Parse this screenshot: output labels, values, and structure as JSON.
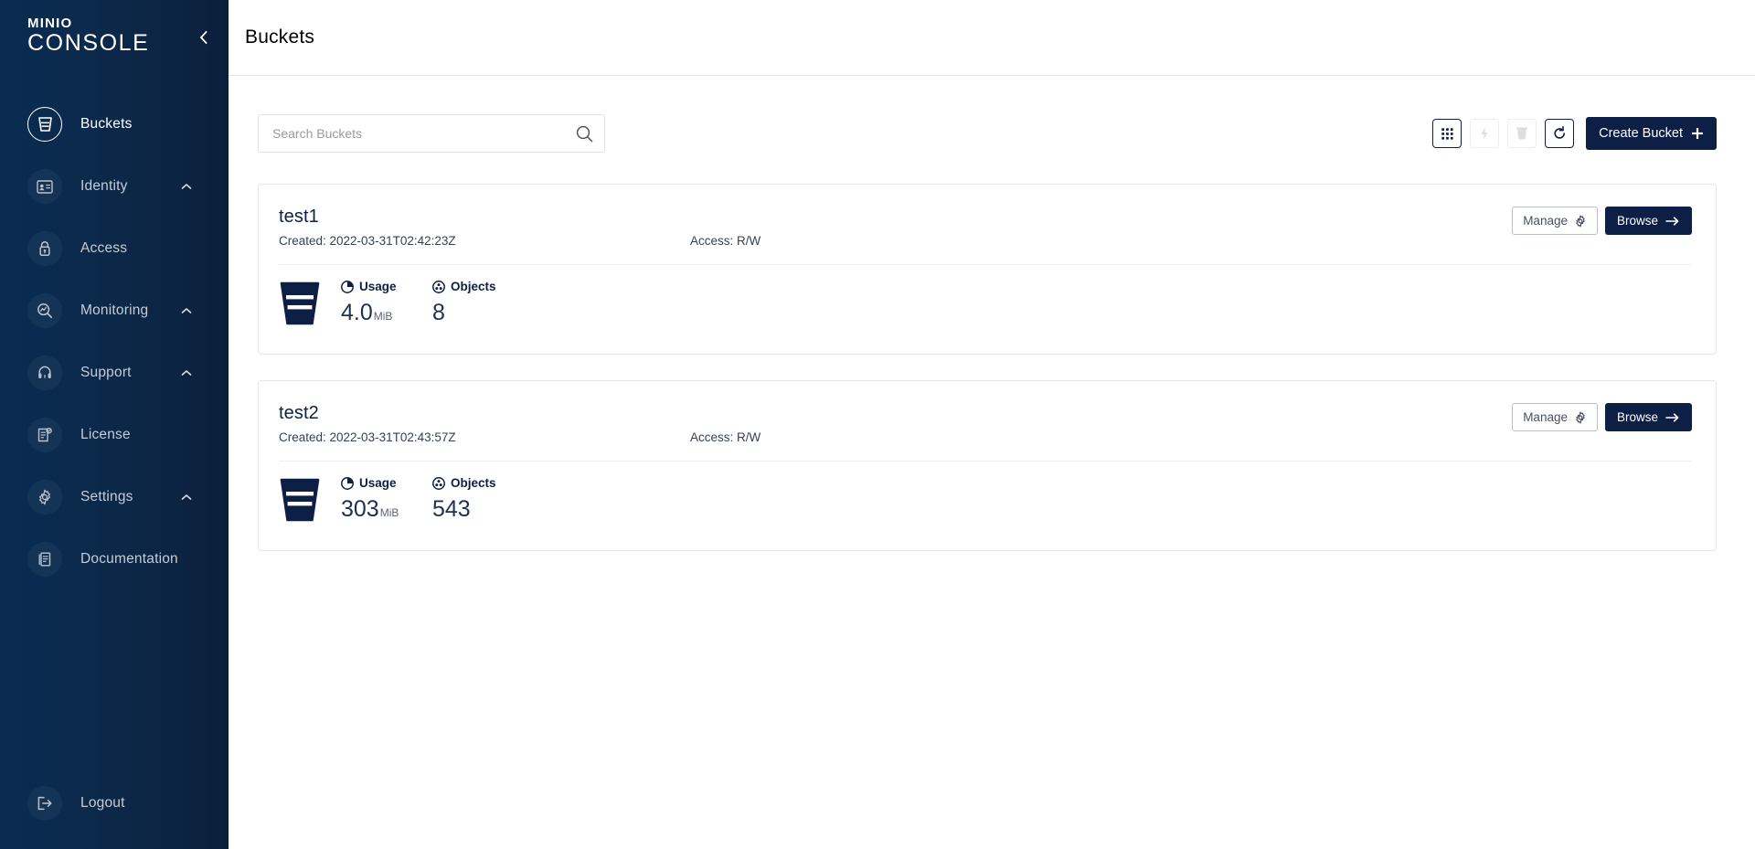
{
  "sidebar": {
    "logo_top": "MINIO",
    "logo_bottom": "CONSOLE",
    "collapse_icon": "chevron-left-icon",
    "items": [
      {
        "label": "Buckets",
        "icon": "bucket-icon",
        "active": true,
        "chevron": false
      },
      {
        "label": "Identity",
        "icon": "identity-card-icon",
        "active": false,
        "chevron": true
      },
      {
        "label": "Access",
        "icon": "lock-icon",
        "active": false,
        "chevron": false
      },
      {
        "label": "Monitoring",
        "icon": "magnifier-chart-icon",
        "active": false,
        "chevron": true
      },
      {
        "label": "Support",
        "icon": "support-headset-icon",
        "active": false,
        "chevron": true
      },
      {
        "label": "License",
        "icon": "license-doc-icon",
        "active": false,
        "chevron": false
      },
      {
        "label": "Settings",
        "icon": "gear-icon",
        "active": false,
        "chevron": true
      },
      {
        "label": "Documentation",
        "icon": "book-icon",
        "active": false,
        "chevron": false
      }
    ],
    "logout": {
      "label": "Logout",
      "icon": "logout-icon"
    }
  },
  "header": {
    "title": "Buckets"
  },
  "toolbar": {
    "search": {
      "placeholder": "Search Buckets",
      "value": "",
      "icon": "search-icon"
    },
    "buttons": [
      {
        "name": "grid-view-button",
        "icon": "grid-icon",
        "disabled": false
      },
      {
        "name": "lifecycle-button",
        "icon": "bolt-icon",
        "disabled": true
      },
      {
        "name": "delete-button",
        "icon": "trash-icon",
        "disabled": true
      },
      {
        "name": "refresh-button",
        "icon": "refresh-icon",
        "disabled": false
      }
    ],
    "create_label": "Create Bucket",
    "create_icon": "plus-icon"
  },
  "labels": {
    "created_prefix": "Created:",
    "access_prefix": "Access:",
    "usage": "Usage",
    "objects": "Objects",
    "manage": "Manage",
    "browse": "Browse",
    "manage_icon": "gear-icon",
    "browse_icon": "arrow-right-icon",
    "usage_icon": "pie-chart-icon",
    "objects_icon": "objects-icon",
    "bucket_glyph": "bucket-icon"
  },
  "buckets": [
    {
      "name": "test1",
      "created": "Created: 2022-03-31T02:42:23Z",
      "access": "Access: R/W",
      "usage_value": "4.0",
      "usage_unit": "MiB",
      "objects": "8"
    },
    {
      "name": "test2",
      "created": "Created: 2022-03-31T02:43:57Z",
      "access": "Access: R/W",
      "usage_value": "303",
      "usage_unit": "MiB",
      "objects": "543"
    }
  ],
  "colors": {
    "sidebar_dark": "#0b1f3b",
    "sidebar_light": "#0a2c52",
    "accent": "#0d1f44",
    "text_primary": "#000000",
    "value_text": "#1e3055",
    "border": "#e4e6ea"
  }
}
